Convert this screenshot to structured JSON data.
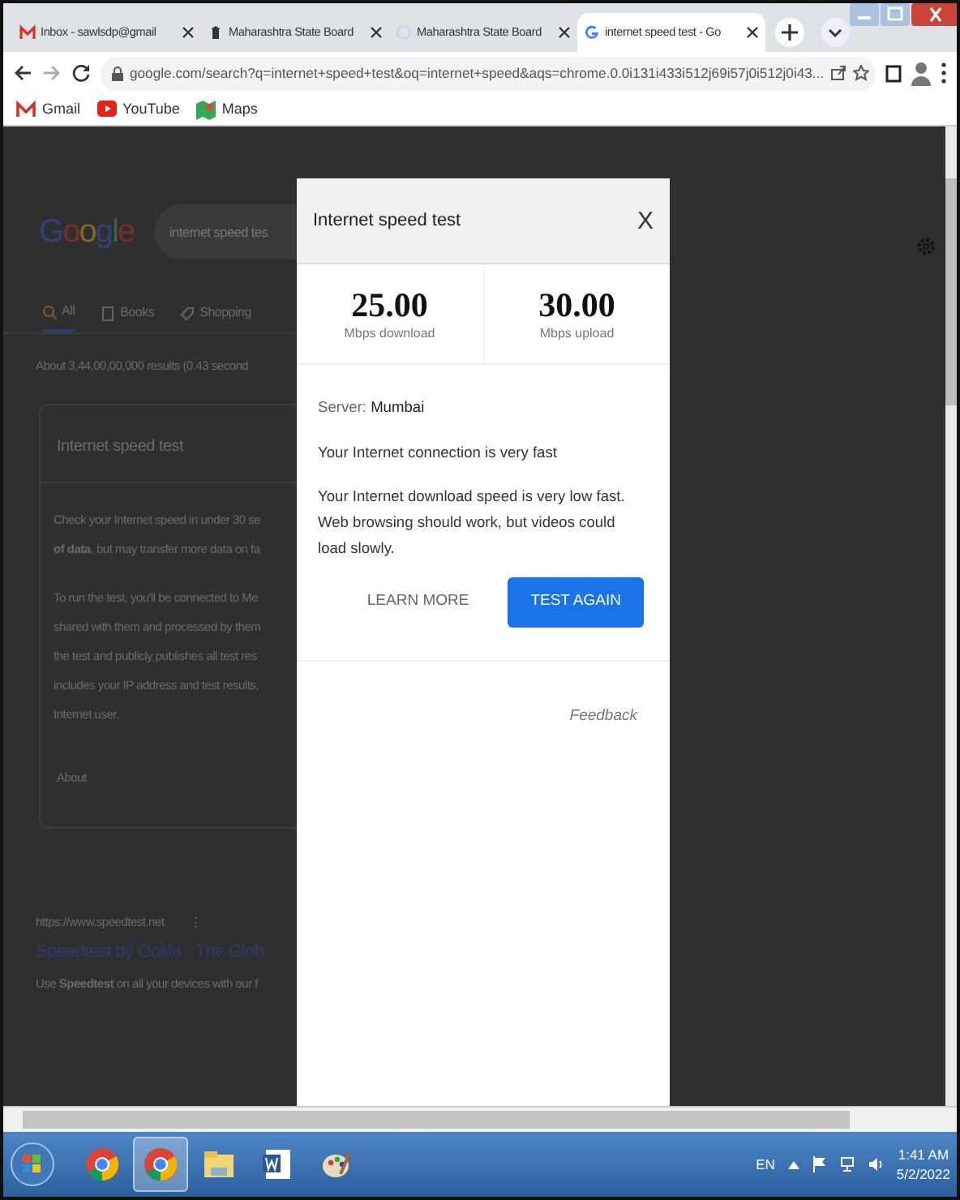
{
  "browser": {
    "tabs": [
      {
        "title": "Inbox - sawlsdp@gmail",
        "kind": "gmail",
        "selected": false
      },
      {
        "title": "Maharashtra State Board",
        "kind": "board",
        "selected": false
      },
      {
        "title": "Maharashtra State Board",
        "kind": "loading",
        "selected": false
      },
      {
        "title": "internet speed test - Go",
        "kind": "google",
        "selected": true
      }
    ],
    "url": "google.com/search?q=internet+speed+test&oq=internet+speed&aqs=chrome.0.0i131i433i512j69i57j0i512j0i43...",
    "bookmarks": [
      {
        "label": "Gmail",
        "kind": "gmail"
      },
      {
        "label": "YouTube",
        "kind": "youtube"
      },
      {
        "label": "Maps",
        "kind": "maps"
      }
    ]
  },
  "page": {
    "logo": "Google",
    "search_value": "internet speed tes",
    "search_tabs": [
      {
        "label": "All",
        "kind": "search",
        "selected": true
      },
      {
        "label": "Books",
        "kind": "book",
        "selected": false
      },
      {
        "label": "Shopping",
        "kind": "tag",
        "selected": false
      }
    ],
    "results_info": "About 3,44,00,00,000 results (0.43 second",
    "card": {
      "title": "Internet speed test",
      "paragraphs": [
        [
          "Check your Internet speed in under 30 se",
          "**of data**, but may transfer more data on fa"
        ],
        [
          "To run the test, you'll be connected to Me",
          "shared with them and processed by them",
          "the test and publicly publishes all test res",
          "includes your IP address and test results,",
          "Internet user."
        ]
      ],
      "about": "About"
    },
    "result": {
      "url": "https://www.speedtest.net",
      "menu": "⋮",
      "title": "Speedtest by Ookla - The Glob",
      "snippet": "Use **Speedtest** on all your devices with our f"
    }
  },
  "dialog": {
    "title": "Internet speed test",
    "close": "X",
    "stats": [
      {
        "value": "25.00",
        "label": "Mbps download"
      },
      {
        "value": "30.00",
        "label": "Mbps upload"
      }
    ],
    "server_label": "Server:",
    "server": "Mumbai",
    "status": "Your Internet connection is very fast",
    "message": "Your Internet download speed is very low fast. Web browsing should work, but videos could load slowly.",
    "buttons": [
      {
        "label": "LEARN MORE",
        "kind": "text"
      },
      {
        "label": "TEST AGAIN",
        "kind": "primary"
      }
    ],
    "feedback": "Feedback"
  },
  "taskbar": {
    "apps": [
      {
        "kind": "chrome",
        "selected": false
      },
      {
        "kind": "chrome",
        "selected": true
      },
      {
        "kind": "folder",
        "selected": false
      },
      {
        "kind": "word",
        "selected": false
      },
      {
        "kind": "paint",
        "selected": false
      }
    ],
    "language": "EN",
    "time": "1:41 AM",
    "date": "5/2/2022"
  }
}
